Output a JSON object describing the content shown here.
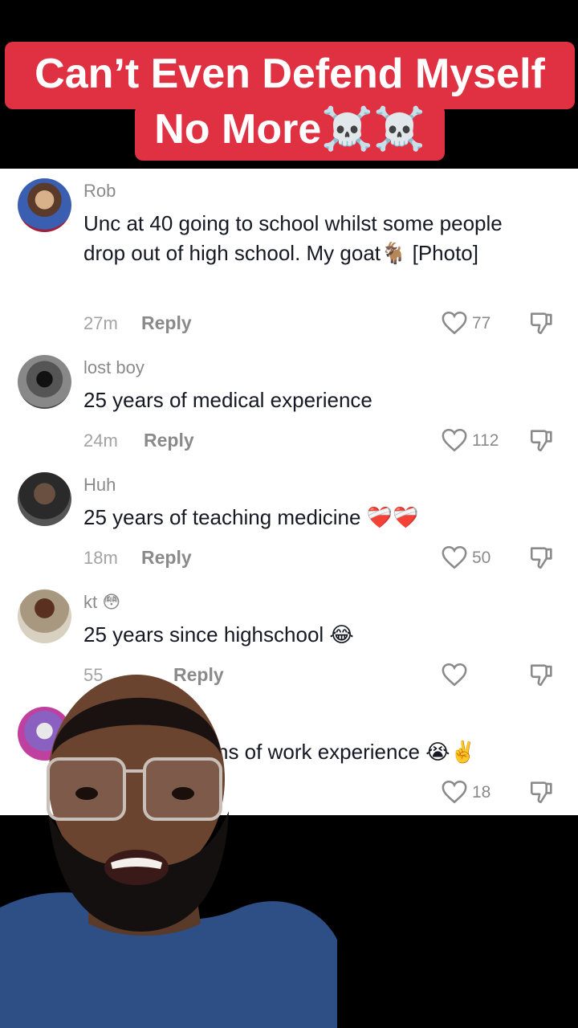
{
  "title": {
    "line1": "Can’t Even Defend Myself",
    "line2": "No More☠️☠️"
  },
  "comments": [
    {
      "username": "Rob",
      "text": "Unc at 40 going to school whilst some people drop out of high school. My goat🐐 [Photo]",
      "time": "27m",
      "reply": "Reply",
      "likes": "77"
    },
    {
      "username": "lost boy",
      "text": "25 years of medical experience",
      "time": "24m",
      "reply": "Reply",
      "likes": "112"
    },
    {
      "username": "Huh",
      "text": "25 years of teaching medicine ❤️‍🩹❤️‍🩹",
      "time": "18m",
      "reply": "Reply",
      "likes": "50"
    },
    {
      "username": "kt 😳",
      "text": "25 years since highschool 😂",
      "time": "55",
      "reply": "Reply",
      "likes": ""
    },
    {
      "username": "",
      "text": "ns of work experience 😭✌️",
      "time": "",
      "reply": "",
      "likes": "18"
    }
  ],
  "icons": {
    "like": "heart-outline-icon",
    "dislike": "thumbs-down-icon"
  },
  "colors": {
    "banner_red": "#e03142",
    "comment_text": "#161823",
    "muted": "#8a8a8a"
  }
}
